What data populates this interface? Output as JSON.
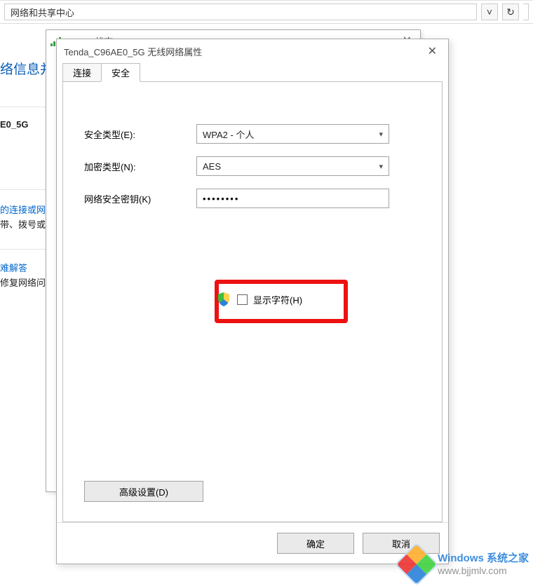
{
  "topbar": {
    "crumb": "网络和共享中心",
    "dropdown_icon": "˅",
    "refresh_icon": "↻"
  },
  "background": {
    "hdr_fragment": "络信息并",
    "ssid": "E0_5G",
    "links": {
      "conn": "的连接或网",
      "conn_desc": "带、拨号或",
      "troubleshoot": "难解答",
      "troubleshoot_desc": "修复网络问"
    }
  },
  "wlan_status": {
    "title": "WLAN 状态"
  },
  "props": {
    "title": "Tenda_C96AE0_5G 无线网络属性",
    "tabs": {
      "conn": "连接",
      "sec": "安全"
    },
    "fields": {
      "sec_type_label": "安全类型(E):",
      "sec_type_value": "WPA2 - 个人",
      "enc_type_label": "加密类型(N):",
      "enc_type_value": "AES",
      "key_label": "网络安全密钥(K)",
      "key_value": "••••••••",
      "show_chars": "显示字符(H)"
    },
    "buttons": {
      "advanced": "高级设置(D)",
      "ok": "确定",
      "cancel": "取消"
    }
  },
  "watermark": {
    "line1": "Windows 系统之家",
    "line2": "www.bjjmlv.com"
  }
}
